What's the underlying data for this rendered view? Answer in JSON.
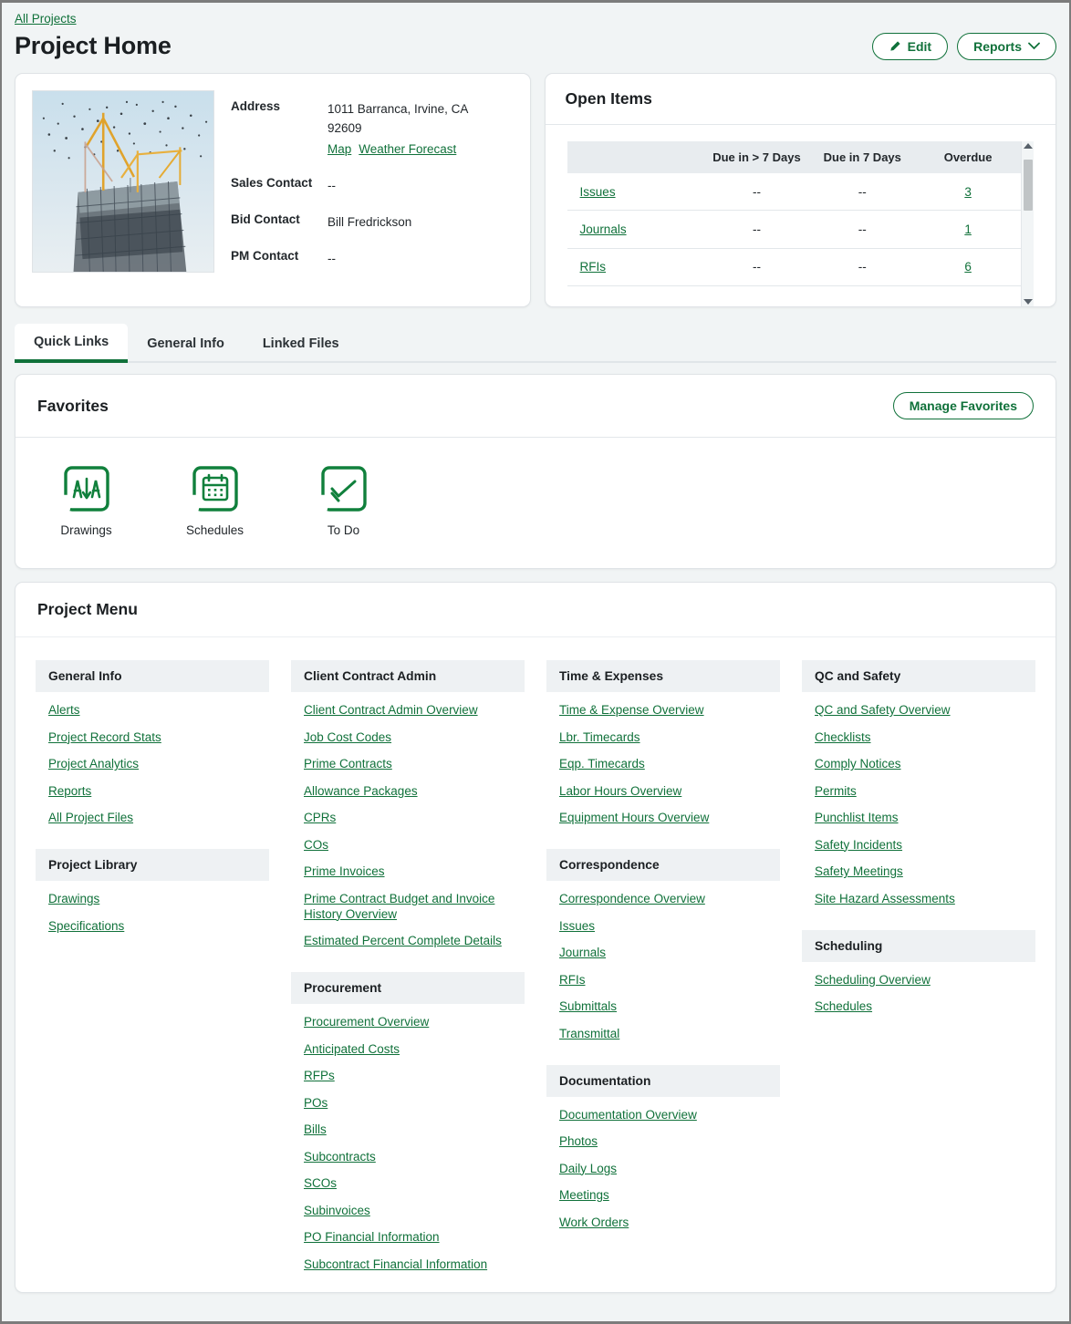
{
  "breadcrumb": {
    "label": "All Projects"
  },
  "header": {
    "title": "Project Home",
    "edit_label": "Edit",
    "reports_label": "Reports"
  },
  "project_info": {
    "image_alt": "construction-site-photo",
    "rows": [
      {
        "label": "Address",
        "value": "1011 Barranca, Irvine, CA 92609",
        "links": [
          "Map",
          "Weather Forecast"
        ]
      },
      {
        "label": "Sales Contact",
        "value": "--"
      },
      {
        "label": "Bid Contact",
        "value": "Bill Fredrickson"
      },
      {
        "label": "PM Contact",
        "value": "--"
      }
    ]
  },
  "open_items": {
    "title": "Open Items",
    "columns": [
      "",
      "Due in > 7 Days",
      "Due in 7 Days",
      "Overdue"
    ],
    "rows": [
      {
        "label": "Issues",
        "due_gt_7": "--",
        "due_7": "--",
        "overdue": "3"
      },
      {
        "label": "Journals",
        "due_gt_7": "--",
        "due_7": "--",
        "overdue": "1"
      },
      {
        "label": "RFIs",
        "due_gt_7": "--",
        "due_7": "--",
        "overdue": "6"
      }
    ]
  },
  "tabs": [
    {
      "label": "Quick Links",
      "active": true
    },
    {
      "label": "General Info",
      "active": false
    },
    {
      "label": "Linked Files",
      "active": false
    }
  ],
  "favorites": {
    "title": "Favorites",
    "manage_label": "Manage Favorites",
    "items": [
      {
        "label": "Drawings",
        "icon": "drawings-icon"
      },
      {
        "label": "Schedules",
        "icon": "calendar-icon"
      },
      {
        "label": "To Do",
        "icon": "double-check-icon"
      }
    ]
  },
  "project_menu": {
    "title": "Project Menu",
    "columns": [
      {
        "groups": [
          {
            "heading": "General Info",
            "links": [
              "Alerts",
              "Project Record Stats",
              "Project Analytics",
              "Reports",
              "All Project Files"
            ]
          },
          {
            "heading": "Project Library",
            "links": [
              "Drawings",
              "Specifications"
            ]
          }
        ]
      },
      {
        "groups": [
          {
            "heading": "Client Contract Admin",
            "links": [
              "Client Contract Admin Overview",
              "Job Cost Codes",
              "Prime Contracts",
              "Allowance Packages",
              "CPRs",
              "COs",
              "Prime Invoices",
              "Prime Contract Budget and Invoice History Overview",
              "Estimated Percent Complete Details"
            ]
          },
          {
            "heading": "Procurement",
            "links": [
              "Procurement Overview",
              "Anticipated Costs",
              "RFPs",
              "POs",
              "Bills",
              "Subcontracts",
              "SCOs",
              "Subinvoices",
              "PO Financial Information",
              "Subcontract Financial Information"
            ]
          }
        ]
      },
      {
        "groups": [
          {
            "heading": "Time & Expenses",
            "links": [
              "Time & Expense Overview",
              "Lbr. Timecards",
              "Eqp. Timecards",
              "Labor Hours Overview",
              "Equipment Hours Overview"
            ]
          },
          {
            "heading": "Correspondence",
            "links": [
              "Correspondence Overview",
              "Issues",
              "Journals",
              "RFIs",
              "Submittals",
              "Transmittal"
            ]
          },
          {
            "heading": "Documentation",
            "links": [
              "Documentation Overview",
              "Photos",
              "Daily Logs",
              "Meetings",
              "Work Orders"
            ]
          }
        ]
      },
      {
        "groups": [
          {
            "heading": "QC and Safety",
            "links": [
              "QC and Safety Overview",
              "Checklists",
              "Comply Notices",
              "Permits",
              "Punchlist Items",
              "Safety Incidents",
              "Safety Meetings",
              "Site Hazard Assessments"
            ]
          },
          {
            "heading": "Scheduling",
            "links": [
              "Scheduling Overview",
              "Schedules"
            ]
          }
        ]
      }
    ]
  },
  "colors": {
    "accent_green": "#10713a",
    "page_bg": "#f1f4f5",
    "card_bg": "#ffffff",
    "group_head_bg": "#eef1f3"
  }
}
